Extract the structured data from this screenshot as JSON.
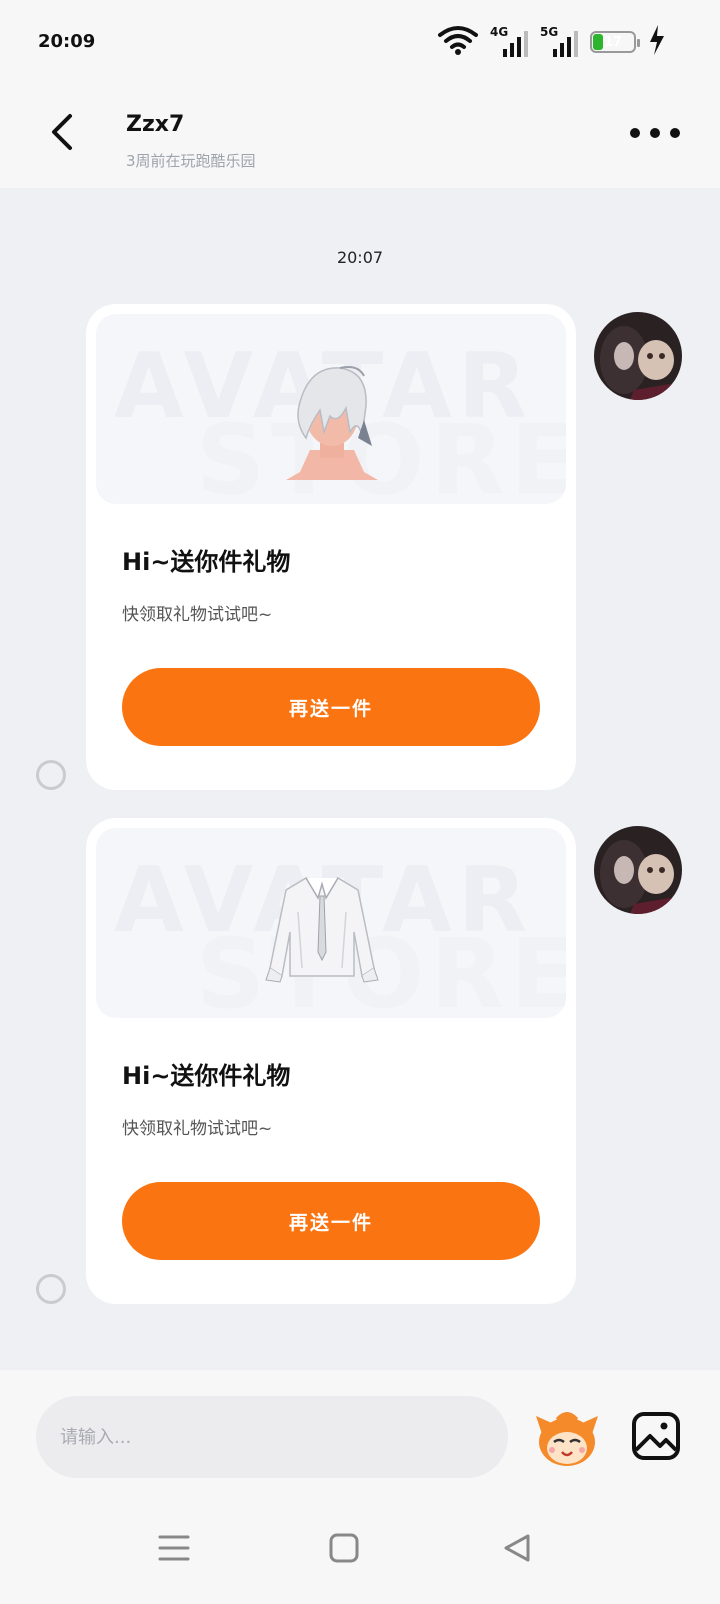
{
  "status_bar": {
    "time": "20:09",
    "net1": "4G",
    "net2": "5G",
    "battery": "17",
    "accent": "#2db52d"
  },
  "header": {
    "name": "Zzx7",
    "subtitle": "3周前在玩跑酷乐园"
  },
  "chat": {
    "timestamp": "20:07",
    "messages": [
      {
        "item_icon": "white-hair-avatar-icon",
        "watermark_top": "AVATAR",
        "watermark_bottom": "STORE",
        "title": "Hi~送你件礼物",
        "desc": "快领取礼物试试吧~",
        "button": "再送一件"
      },
      {
        "item_icon": "white-shirt-icon",
        "watermark_top": "AVATAR",
        "watermark_bottom": "STORE",
        "title": "Hi~送你件礼物",
        "desc": "快领取礼物试试吧~",
        "button": "再送一件"
      }
    ]
  },
  "composer": {
    "placeholder": "请输入..."
  },
  "colors": {
    "accent": "#fb7412",
    "background": "#eef0f3"
  }
}
